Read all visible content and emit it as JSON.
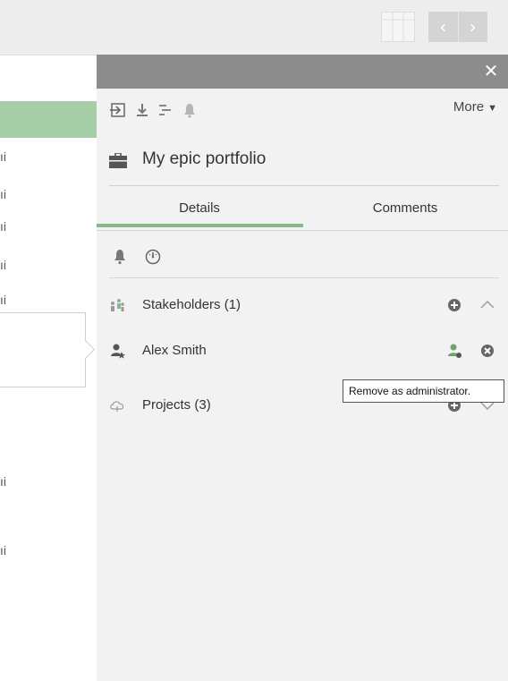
{
  "topbar": {
    "grid_icon": "grid-view-icon",
    "prev_label": "‹",
    "next_label": "›"
  },
  "left_list": {
    "fragments": [
      "ıi",
      "ıi",
      "ıi",
      "ıi",
      "ıi",
      "ıi",
      "ıi"
    ]
  },
  "panel": {
    "close_label": "✕",
    "toolbar": {
      "icons": [
        "export-icon",
        "download-icon",
        "gantt-icon",
        "bell-icon"
      ],
      "more_label": "More"
    },
    "title": "My epic portfolio",
    "tabs": [
      {
        "label": "Details",
        "active": true
      },
      {
        "label": "Comments",
        "active": false
      }
    ],
    "detail_icons": [
      "bell-icon",
      "gauge-icon"
    ],
    "stakeholders": {
      "label": "Stakeholders (1)",
      "members": [
        {
          "name": "Alex Smith"
        }
      ]
    },
    "projects": {
      "label": "Projects (3)"
    },
    "tooltip": "Remove as administrator."
  },
  "colors": {
    "accent_green": "#86b68a",
    "row_highlight": "#a6cfa8",
    "panel_header": "#8c8c8c",
    "panel_bg": "#f2f2f2"
  }
}
